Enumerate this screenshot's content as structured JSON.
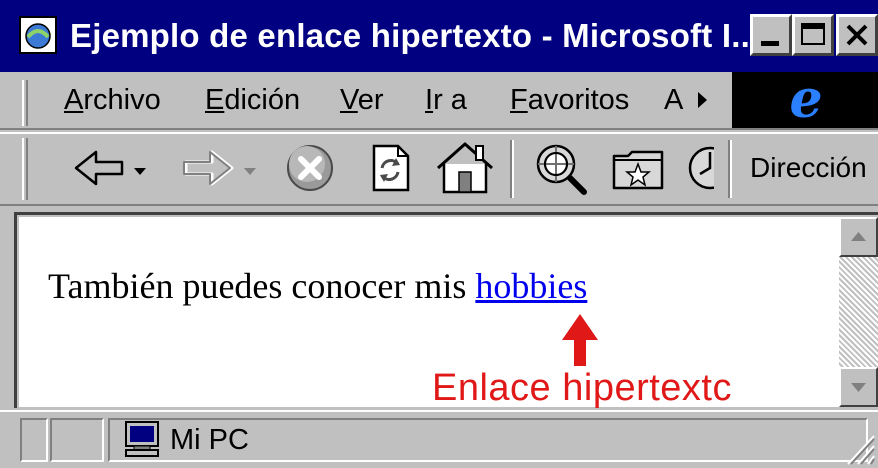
{
  "window": {
    "title": "Ejemplo de enlace hipertexto - Microsoft I..."
  },
  "menu": {
    "items": [
      {
        "underline": "A",
        "rest": "rchivo"
      },
      {
        "underline": "E",
        "rest": "dición"
      },
      {
        "underline": "V",
        "rest": "er"
      },
      {
        "underline": "I",
        "rest": "r a"
      },
      {
        "underline": "F",
        "rest": "avoritos"
      },
      {
        "underline": "",
        "rest": "A"
      }
    ]
  },
  "toolbar": {
    "buttons": [
      "back-arrow-icon",
      "forward-arrow-icon",
      "stop-icon",
      "refresh-icon",
      "home-icon",
      "search-icon",
      "favorites-folder-icon",
      "history-icon"
    ],
    "address_label": "Dirección"
  },
  "content": {
    "text_before_link": "También puedes conocer mis ",
    "link_text": "hobbies",
    "annotation": "Enlace hipertextc"
  },
  "statusbar": {
    "zone_label": "Mi PC",
    "zone_icon": "computer-icon"
  },
  "colors": {
    "titlebar": "#000080",
    "link": "#0000ee",
    "annotation": "#e01818"
  }
}
